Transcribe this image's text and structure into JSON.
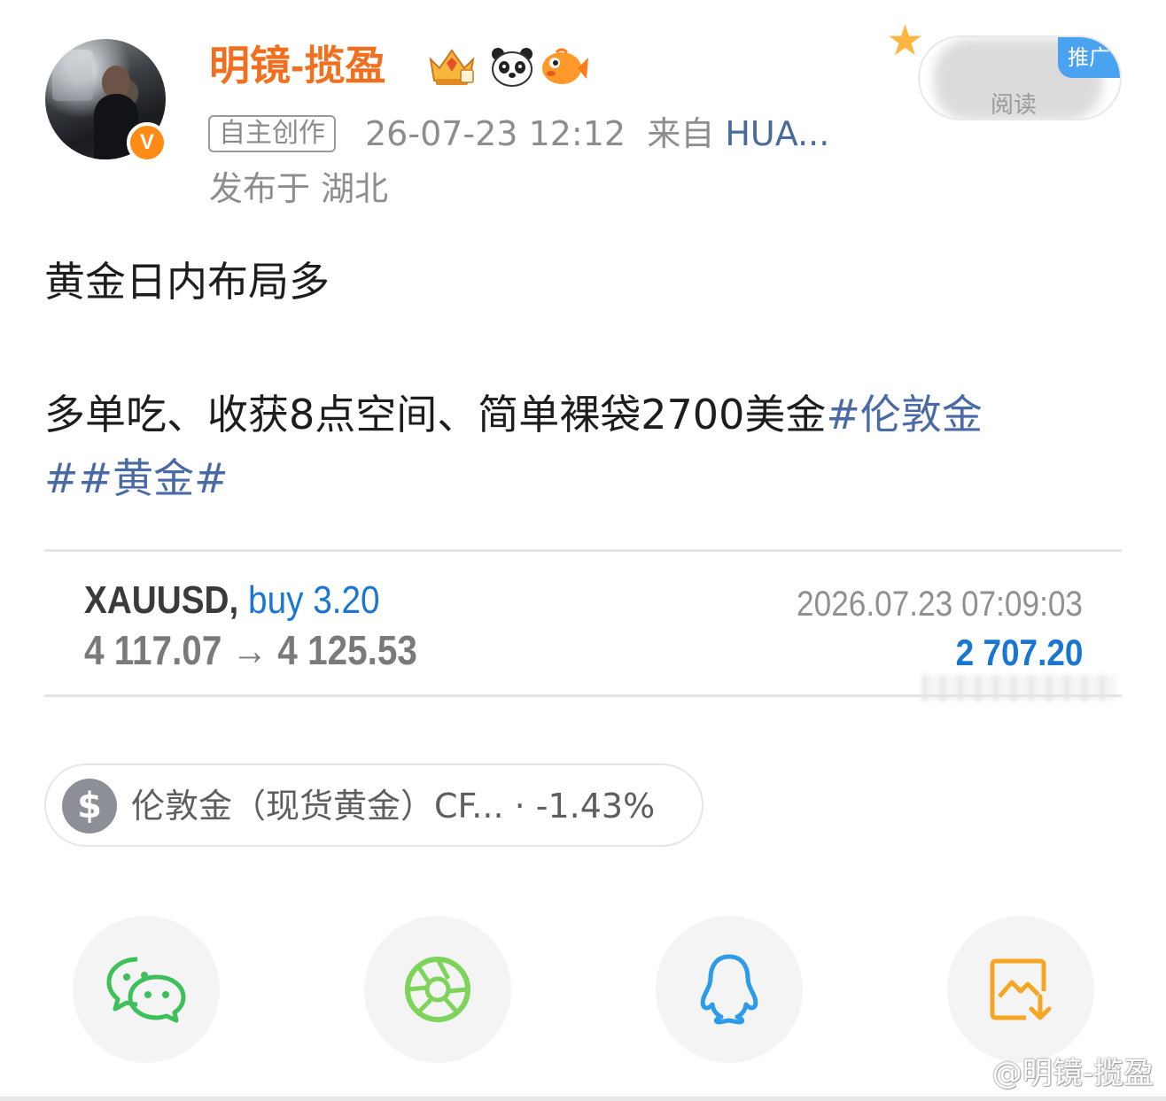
{
  "header": {
    "username": "明镜-揽盈",
    "badges": [
      "crown-badge-icon",
      "panda-badge-icon",
      "fish-badge-icon"
    ],
    "verified_icon": "verified-v-icon",
    "verified_label": "V",
    "original_tag": "自主创作",
    "timestamp": "26-07-23 12:12",
    "source_prefix": "来自",
    "source_device": "HUA...",
    "location": "发布于 湖北",
    "promo_tag": "推广",
    "promo_label": "阅读"
  },
  "post": {
    "line1": "黄金日内布局多",
    "line2_text": "多单吃、收获8点空间、简单裸袋2700美金",
    "line2_hashtag": "#伦敦金",
    "line3_hashtag": "##黄金#"
  },
  "trade_card": {
    "symbol": "XAUUSD,",
    "side": "buy 3.20",
    "prices": "4 117.07 → 4 125.53",
    "time": "2026.07.23 07:09:03",
    "profit": "2 707.20"
  },
  "stock_chip": {
    "icon_label": "$",
    "text": "伦敦金（现货黄金）CF... · -1.43%"
  },
  "share": {
    "items": [
      "wechat-icon",
      "moments-icon",
      "qq-icon",
      "save-image-icon"
    ]
  },
  "watermark": "@明镜-揽盈",
  "colors": {
    "username": "#f07020",
    "hashtag": "#4a6aa6",
    "trade_side": "#1976d2",
    "wechat": "#3cc15a",
    "moments": "#7ed35a",
    "qq": "#2c9be8",
    "save": "#f5a623"
  }
}
